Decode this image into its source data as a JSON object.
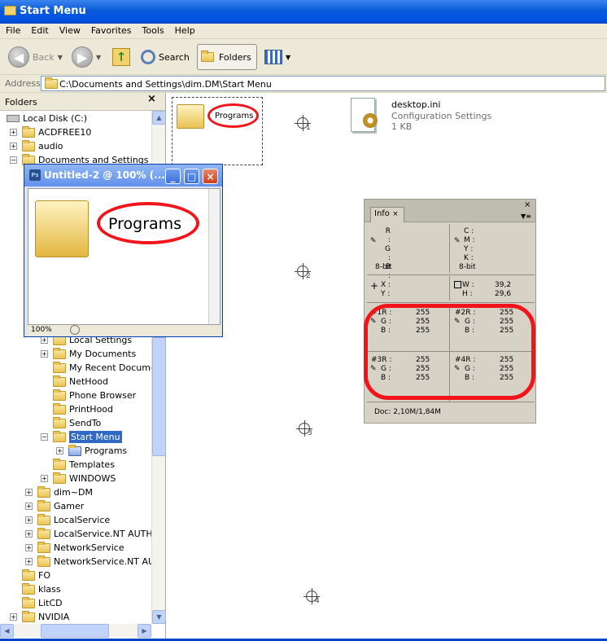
{
  "window": {
    "title": "Start Menu"
  },
  "menu": [
    "File",
    "Edit",
    "View",
    "Favorites",
    "Tools",
    "Help"
  ],
  "toolbar": {
    "back": "Back",
    "search": "Search",
    "folders": "Folders"
  },
  "address": {
    "label": "Address",
    "value": "C:\\Documents and Settings\\dim.DM\\Start Menu"
  },
  "folders_pane": {
    "title": "Folders",
    "close": "×"
  },
  "tree": [
    {
      "label": "Local Disk (C:)"
    },
    {
      "label": "ACDFREE10"
    },
    {
      "label": "audio"
    },
    {
      "label": "Documents and Settings"
    },
    {
      "label": "Local Settings"
    },
    {
      "label": "My Documents"
    },
    {
      "label": "My Recent Documen"
    },
    {
      "label": "NetHood"
    },
    {
      "label": "Phone Browser"
    },
    {
      "label": "PrintHood"
    },
    {
      "label": "SendTo"
    },
    {
      "label": "Start Menu"
    },
    {
      "label": "Programs"
    },
    {
      "label": "Templates"
    },
    {
      "label": "WINDOWS"
    },
    {
      "label": "dim~DM"
    },
    {
      "label": "Gamer"
    },
    {
      "label": "LocalService"
    },
    {
      "label": "LocalService.NT AUTHOF"
    },
    {
      "label": "NetworkService"
    },
    {
      "label": "NetworkService.NT AUTH"
    },
    {
      "label": "FO"
    },
    {
      "label": "klass"
    },
    {
      "label": "LitCD"
    },
    {
      "label": "NVIDIA"
    }
  ],
  "files": [
    {
      "name": "Programs"
    },
    {
      "name": "desktop.ini",
      "type": "Configuration Settings",
      "size": "1 KB"
    }
  ],
  "ps_window": {
    "title": "Untitled-2 @ 100% (...",
    "label": "Programs",
    "zoom": "100%"
  },
  "info_panel": {
    "tab": "Info",
    "rgb": [
      "R :",
      "G :",
      "B :"
    ],
    "cmyk": [
      "C :",
      "M :",
      "Y :",
      "K :"
    ],
    "bits_left": "8-bit",
    "bits_right": "8-bit",
    "xy": [
      "X :",
      "Y :"
    ],
    "wh": [
      "W :",
      "H :"
    ],
    "w": "39,2",
    "h": "29,6",
    "samplers": [
      {
        "labels": [
          "#1R :",
          "G :",
          "B :"
        ],
        "values": [
          "255",
          "255",
          "255"
        ]
      },
      {
        "labels": [
          "#2R :",
          "G :",
          "B :"
        ],
        "values": [
          "255",
          "255",
          "255"
        ]
      },
      {
        "labels": [
          "#3R :",
          "G :",
          "B :"
        ],
        "values": [
          "255",
          "255",
          "255"
        ]
      },
      {
        "labels": [
          "#4R :",
          "G :",
          "B :"
        ],
        "values": [
          "255",
          "255",
          "255"
        ]
      }
    ],
    "doc": "Doc: 2,10M/1,84M"
  },
  "markers": [
    "1",
    "2",
    "3",
    "4"
  ]
}
